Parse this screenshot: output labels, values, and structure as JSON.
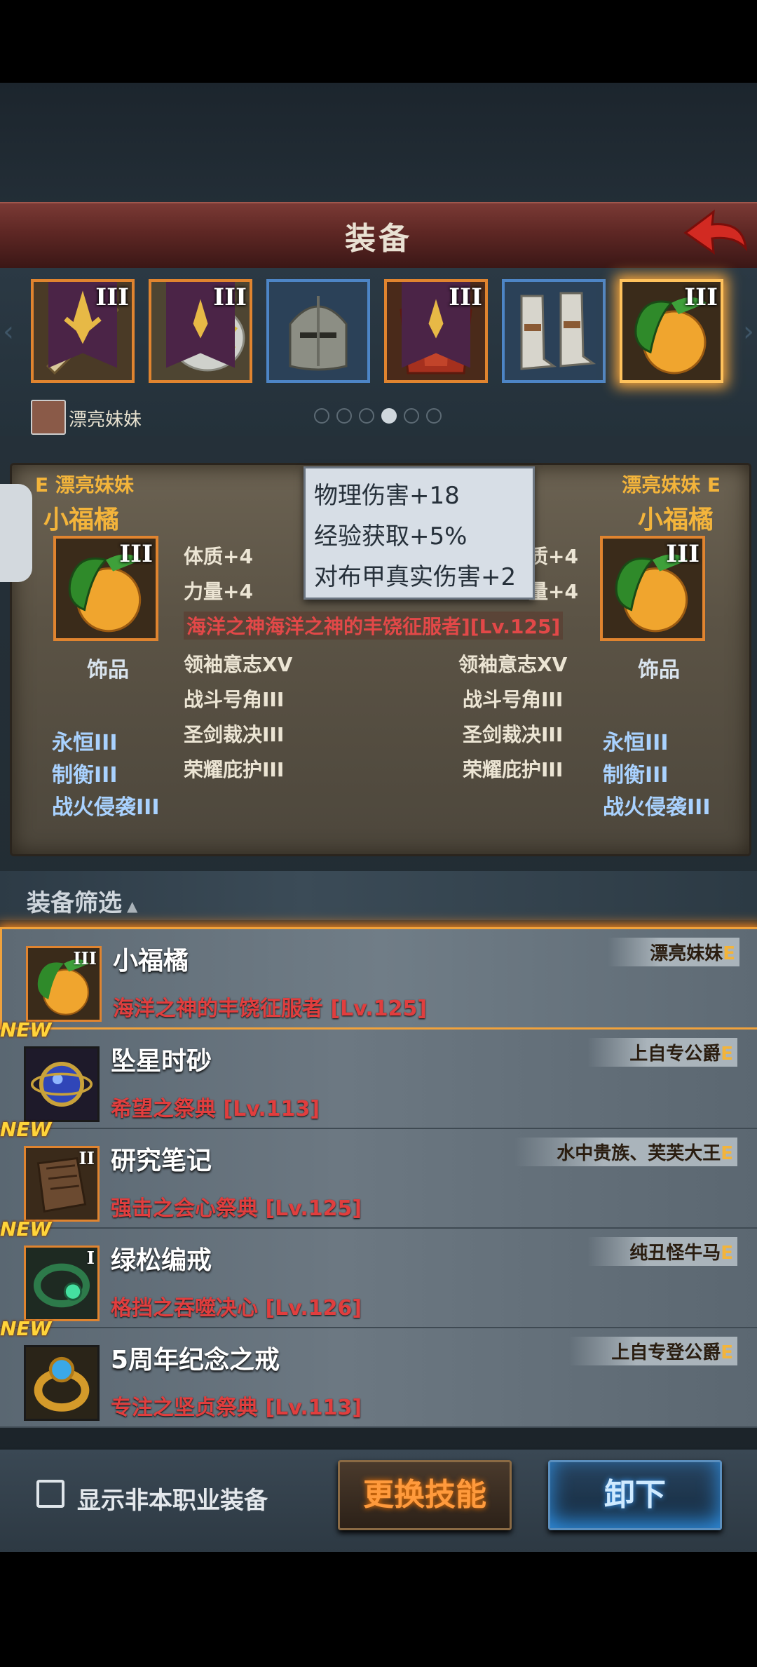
{
  "title": "装备",
  "slots": [
    {
      "tier": "III",
      "name": "weapon"
    },
    {
      "tier": "III",
      "name": "armor"
    },
    {
      "tier": "",
      "name": "helmet"
    },
    {
      "tier": "III",
      "name": "chest"
    },
    {
      "tier": "",
      "name": "boots"
    },
    {
      "tier": "III",
      "name": "accessory"
    }
  ],
  "owner": {
    "name": "漂亮妹妹"
  },
  "pager": {
    "count": 6,
    "active": 3
  },
  "compare": {
    "left": {
      "badge": "E",
      "owner": "漂亮妹妹",
      "item": "小福橘",
      "tier": "III",
      "type": "饰品",
      "extra": [
        "永恒III",
        "制衡III",
        "战火侵袭III"
      ]
    },
    "right": {
      "badge": "E",
      "owner": "漂亮妹妹",
      "item": "小福橘",
      "tier": "III",
      "type": "饰品",
      "extra": [
        "永恒III",
        "制衡III",
        "战火侵袭III"
      ]
    },
    "stats_left": [
      "体质+4",
      "力量+4"
    ],
    "stats_right": [
      "质+4",
      "量+4"
    ],
    "set_line": "海洋之神海洋之神的丰饶征服者][Lv.125]",
    "skills_left": [
      "领袖意志XV",
      "战斗号角III",
      "圣剑裁决III",
      "荣耀庇护III"
    ],
    "skills_right": [
      "领袖意志XV",
      "战斗号角III",
      "圣剑裁决III",
      "荣耀庇护III"
    ]
  },
  "tooltip": [
    "物理伤害+18",
    "经验获取+5%",
    "对布甲真实伤害+2"
  ],
  "filter": {
    "label": "装备筛选"
  },
  "list": [
    {
      "new": "",
      "name": "小福橘",
      "set": "海洋之神的丰饶征服者 [Lv.125]",
      "owner": "漂亮妹妹",
      "e": "E",
      "tier": "III"
    },
    {
      "new": "NEW",
      "name": "坠星时砂",
      "set": "希望之祭典 [Lv.113]",
      "owner": "上自专公爵",
      "e": "E",
      "tier": ""
    },
    {
      "new": "NEW",
      "name": "研究笔记",
      "set": "强击之会心祭典 [Lv.125]",
      "owner": "水中贵族、芙芙大王",
      "e": "E",
      "tier": "II"
    },
    {
      "new": "NEW",
      "name": "绿松编戒",
      "set": "格挡之吞噬决心 [Lv.126]",
      "owner": "纯丑怪牛马",
      "e": "E",
      "tier": "I"
    },
    {
      "new": "NEW",
      "name": "5周年纪念之戒",
      "set": "专注之坚贞祭典 [Lv.113]",
      "owner": "上自专登公爵",
      "e": "E",
      "tier": ""
    }
  ],
  "bottom": {
    "checkbox_label": "显示非本职业装备",
    "swap_label": "更换技能",
    "unequip_label": "卸下"
  },
  "colors": {
    "accent_orange": "#e0842f",
    "set_red": "#e24848",
    "gold": "#f3b43b",
    "title_bar": "#5e2724"
  }
}
